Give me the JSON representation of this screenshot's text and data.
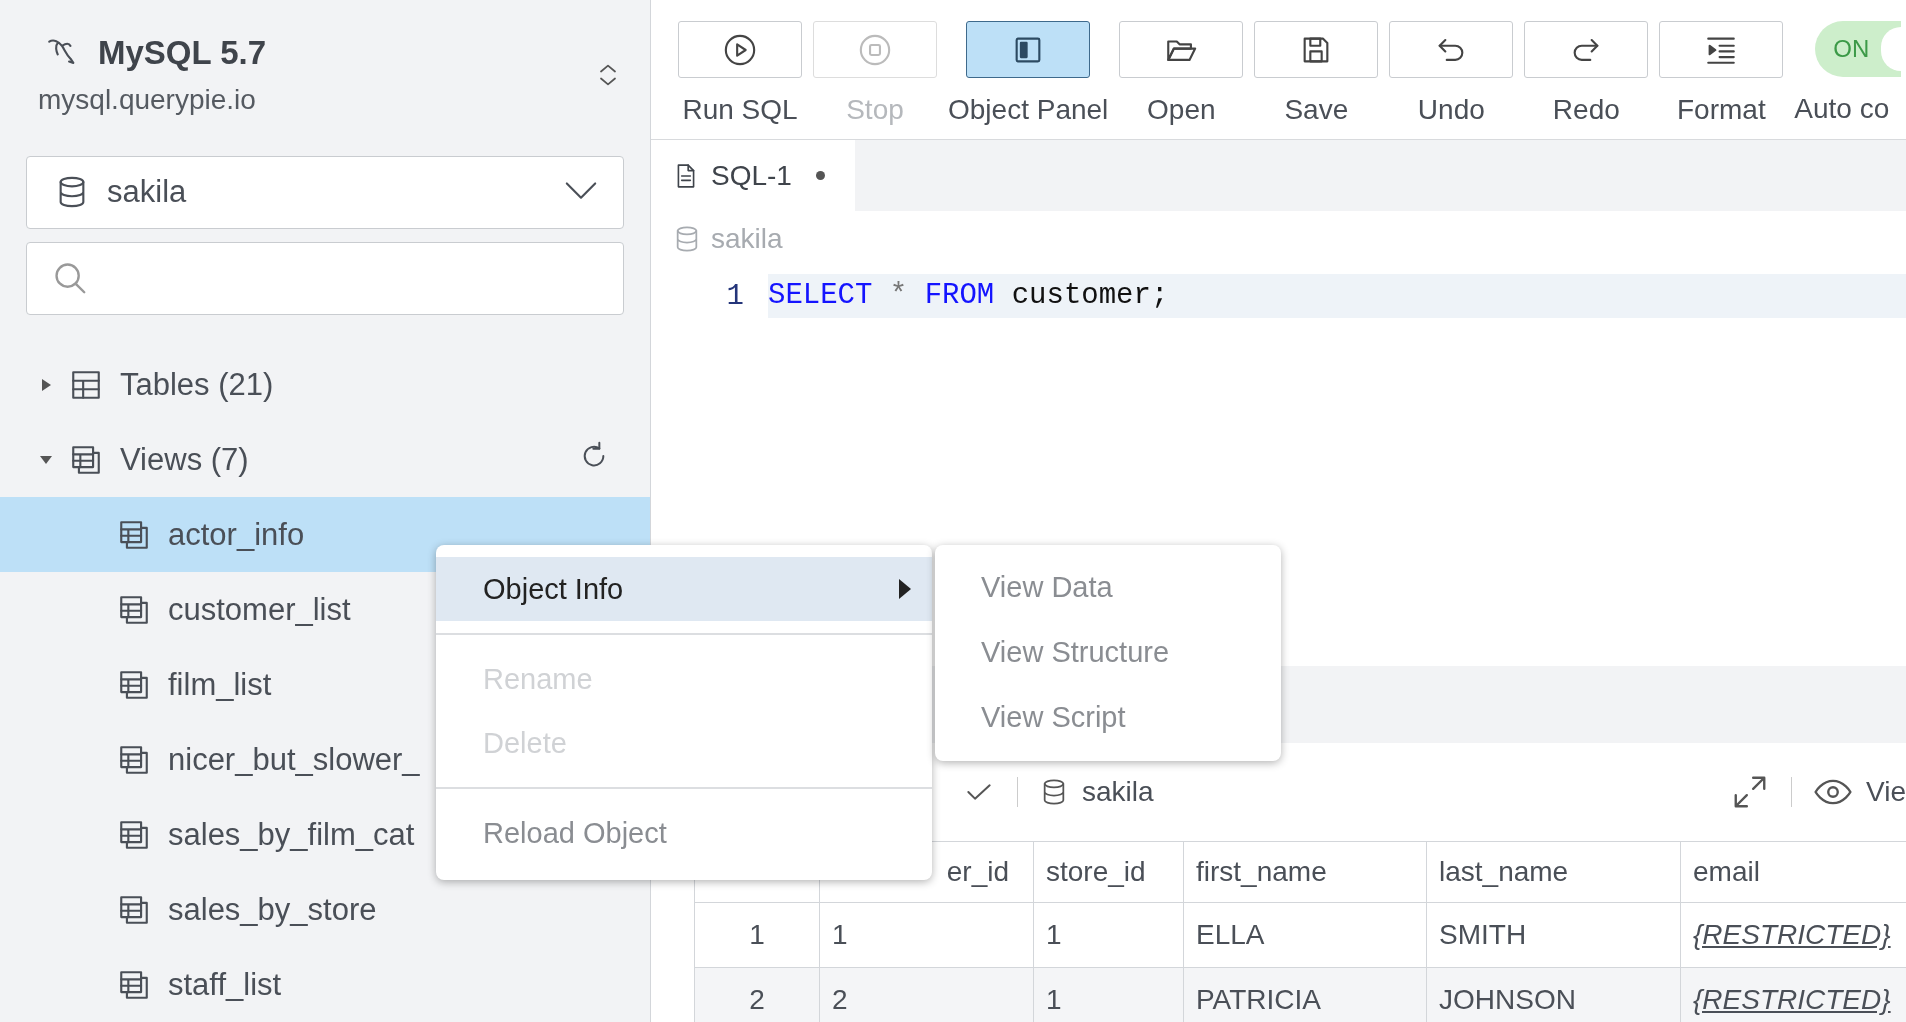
{
  "connection": {
    "name": "MySQL 5.7",
    "host": "mysql.querypie.io"
  },
  "database_select": {
    "value": "sakila"
  },
  "tree": [
    {
      "label": "Tables (21)",
      "kind": "table",
      "expanded": false,
      "selected": false,
      "refresh": false
    },
    {
      "label": "Views (7)",
      "kind": "view",
      "expanded": true,
      "selected": false,
      "refresh": true,
      "children": [
        {
          "label": "actor_info",
          "kind": "view",
          "selected": true
        },
        {
          "label": "customer_list",
          "kind": "view",
          "selected": false
        },
        {
          "label": "film_list",
          "kind": "view",
          "selected": false
        },
        {
          "label": "nicer_but_slower_",
          "kind": "view",
          "selected": false
        },
        {
          "label": "sales_by_film_cat",
          "kind": "view",
          "selected": false
        },
        {
          "label": "sales_by_store",
          "kind": "view",
          "selected": false
        },
        {
          "label": "staff_list",
          "kind": "view",
          "selected": false
        }
      ]
    }
  ],
  "toolbar": [
    {
      "kind": "run",
      "label": "Run SQL",
      "disabled": false,
      "selected": false
    },
    {
      "kind": "stop",
      "label": "Stop",
      "disabled": true,
      "selected": false
    },
    {
      "kind": "panel",
      "label": "Object Panel",
      "disabled": false,
      "selected": true
    },
    {
      "kind": "open",
      "label": "Open",
      "disabled": false,
      "selected": false
    },
    {
      "kind": "save",
      "label": "Save",
      "disabled": false,
      "selected": false
    },
    {
      "kind": "undo",
      "label": "Undo",
      "disabled": false,
      "selected": false
    },
    {
      "kind": "redo",
      "label": "Redo",
      "disabled": false,
      "selected": false
    },
    {
      "kind": "format",
      "label": "Format",
      "disabled": false,
      "selected": false
    },
    {
      "kind": "toggle",
      "label": "Auto co",
      "state_text": "ON",
      "on": true
    }
  ],
  "editor_tabs": [
    {
      "label": "SQL-1",
      "modified": true,
      "selected": true
    }
  ],
  "editor": {
    "database": "sakila",
    "lines": [
      {
        "number": "1",
        "tokens": [
          {
            "kind": "keyword",
            "text": "SELECT"
          },
          {
            "kind": "operator",
            "text": "*"
          },
          {
            "kind": "keyword",
            "text": "FROM"
          },
          {
            "kind": "plain",
            "text": "customer;"
          }
        ]
      }
    ]
  },
  "results": {
    "database": "sakila",
    "view_label": "Vie",
    "columns": [
      {
        "label": "er_id",
        "kind": "text"
      },
      {
        "label": "store_id",
        "kind": "text"
      },
      {
        "label": "first_name",
        "kind": "text"
      },
      {
        "label": "last_name",
        "kind": "text"
      },
      {
        "label": "email",
        "kind": "masked"
      }
    ],
    "rows": [
      {
        "number": "1",
        "cells": [
          "1",
          "1",
          "ELLA",
          "SMITH",
          "{RESTRICTED}"
        ]
      },
      {
        "number": "2",
        "cells": [
          "2",
          "1",
          "PATRICIA",
          "JOHNSON",
          "{RESTRICTED}"
        ]
      }
    ]
  },
  "context_menu": {
    "items": [
      {
        "kind": "item",
        "label": "Object Info",
        "selected": true,
        "disabled": false,
        "submenu": true
      },
      {
        "kind": "separator"
      },
      {
        "kind": "item",
        "label": "Rename",
        "selected": false,
        "disabled": true,
        "submenu": false
      },
      {
        "kind": "item",
        "label": "Delete",
        "selected": false,
        "disabled": true,
        "submenu": false
      },
      {
        "kind": "separator"
      },
      {
        "kind": "item",
        "label": "Reload Object",
        "selected": false,
        "disabled": false,
        "submenu": false
      }
    ],
    "submenu": [
      {
        "label": "View Data",
        "selected": false,
        "disabled": false
      },
      {
        "label": "View Structure",
        "selected": false,
        "disabled": false
      },
      {
        "label": "View Script",
        "selected": false,
        "disabled": false
      }
    ]
  }
}
